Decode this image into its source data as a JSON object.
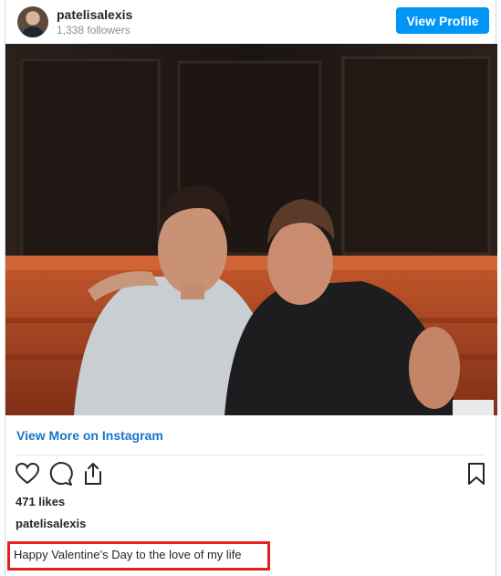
{
  "header": {
    "username": "patelisalexis",
    "followers": "1,338 followers",
    "view_profile_label": "View Profile"
  },
  "colors": {
    "accent": "#0095f6",
    "link": "#1877c9",
    "highlight_box": "#e2211c"
  },
  "actions": {
    "view_more_label": "View More on Instagram",
    "icons": [
      "heart-icon",
      "comment-icon",
      "share-icon",
      "bookmark-icon"
    ]
  },
  "post": {
    "likes": "471 likes",
    "caption_user": "patelisalexis",
    "caption_text": "Happy Valentine’s Day to the love of my life"
  }
}
